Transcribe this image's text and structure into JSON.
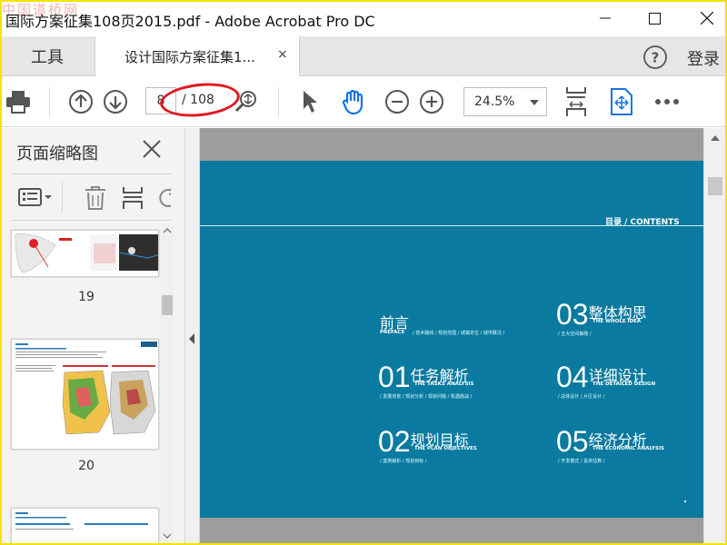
{
  "window": {
    "title": "国际方案征集108页2015.pdf - Adobe Acrobat Pro DC",
    "watermark": "中国道桥网"
  },
  "tabs": {
    "tools_label": "工具",
    "doc_tab_label": "设计国际方案征集1...",
    "tab_close": "×",
    "login_label": "登录"
  },
  "toolbar": {
    "current_page": "8",
    "page_total": "/ 108",
    "zoom_value": "24.5%"
  },
  "sidebar": {
    "panel_title": "页面缩略图",
    "thumbnails": [
      {
        "page_label": "19"
      },
      {
        "page_label": "20"
      }
    ]
  },
  "document": {
    "contents_heading": "目录 / CONTENTS",
    "sections": [
      {
        "num": "",
        "cn": "前言",
        "en": "PREFACE",
        "sub": "/ 技术路线 / 规划范围 / 城镇定位 / 城市概况 /"
      },
      {
        "num": "01",
        "cn": "任务解析",
        "en": "THE TASKS ANALYSIS",
        "sub": "/ 发展背景 / 现状分析 / 现状问题 / 机遇挑战 /"
      },
      {
        "num": "02",
        "cn": "规划目标",
        "en": "THE PLAN OBJECTIVES",
        "sub": "/ 案例解析 / 规划目标 /"
      },
      {
        "num": "03",
        "cn": "整体构思",
        "en": "THE WHOLE IDEA",
        "sub": "/ 五大空间策略 /"
      },
      {
        "num": "04",
        "cn": "详细设计",
        "en": "THE DETAILED DESIGN",
        "sub": "/ 总体设计 / 片区设计 /"
      },
      {
        "num": "05",
        "cn": "经济分析",
        "en": "THE ECONOMIC ANALYSIS",
        "sub": "/ 开发模式 / 投资估算 /"
      }
    ]
  },
  "colors": {
    "page_bg": "#0a7aa0",
    "accent_blue": "#1473e6",
    "highlight_red": "#e0191f",
    "frame_yellow": "#f2e400"
  }
}
